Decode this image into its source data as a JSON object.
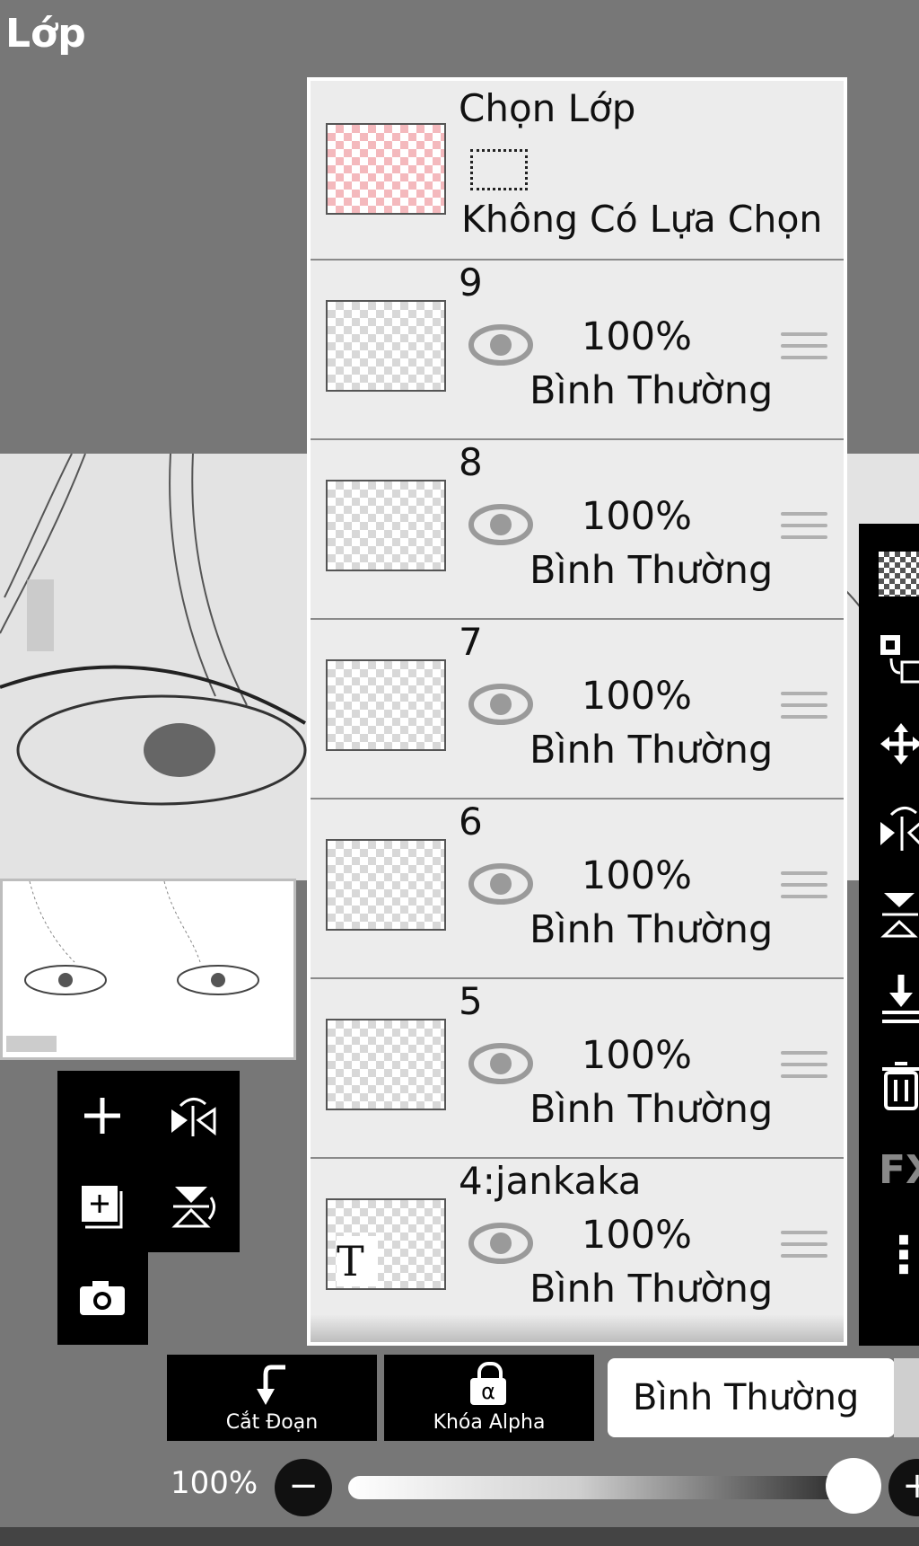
{
  "header": {
    "title": "Lớp"
  },
  "selection_row": {
    "title": "Chọn Lớp",
    "status": "Không Có Lựa Chọn"
  },
  "layers": [
    {
      "name": "9",
      "opacity": "100%",
      "blend": "Bình Thường",
      "visible": true
    },
    {
      "name": "8",
      "opacity": "100%",
      "blend": "Bình Thường",
      "visible": true
    },
    {
      "name": "7",
      "opacity": "100%",
      "blend": "Bình Thường",
      "visible": true
    },
    {
      "name": "6",
      "opacity": "100%",
      "blend": "Bình Thường",
      "visible": true
    },
    {
      "name": "5",
      "opacity": "100%",
      "blend": "Bình Thường",
      "visible": true
    },
    {
      "name": "4:jankaka",
      "opacity": "100%",
      "blend": "Bình Thường",
      "visible": true,
      "text_layer_glyph": "T"
    }
  ],
  "left_tools": [
    "add-layer",
    "flip-horizontal",
    "add-layer-copy",
    "flip-vertical",
    "camera"
  ],
  "right_tools": [
    "transparency",
    "select-transform",
    "move",
    "flip-h-arrow",
    "flip-v-arrow",
    "merge-down",
    "delete",
    "FX",
    "more"
  ],
  "right_tools_labels": {
    "fx": "FX",
    "more": "⋮"
  },
  "bottom_bar": {
    "clip_label": "Cắt Đoạn",
    "alpha_lock_label": "Khóa Alpha",
    "alpha_glyph": "α",
    "blend_mode": "Bình Thường"
  },
  "opacity": {
    "label": "100%",
    "value": 1.0,
    "minus": "−",
    "plus": "+"
  },
  "colors": {
    "background": "#777777",
    "panel": "#ececec",
    "toolbar": "#000000"
  }
}
